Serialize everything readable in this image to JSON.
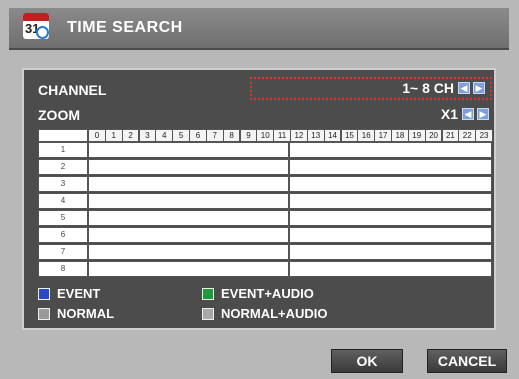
{
  "dialog": {
    "title": "TIME SEARCH",
    "icon": "calendar-clock-icon",
    "icon_number": "31"
  },
  "channel": {
    "label": "CHANNEL",
    "value": "1~ 8 CH"
  },
  "zoom": {
    "label": "ZOOM",
    "value": "X1"
  },
  "hours": [
    "0",
    "1",
    "2",
    "3",
    "4",
    "5",
    "6",
    "7",
    "8",
    "9",
    "10",
    "11",
    "12",
    "13",
    "14",
    "15",
    "16",
    "17",
    "18",
    "19",
    "20",
    "21",
    "22",
    "23"
  ],
  "rows": [
    "1",
    "2",
    "3",
    "4",
    "5",
    "6",
    "7",
    "8"
  ],
  "legend": {
    "event": {
      "label": "EVENT",
      "color": "#2a48c8"
    },
    "event_audio": {
      "label": "EVENT+AUDIO",
      "color": "#1f9a3a"
    },
    "normal": {
      "label": "NORMAL",
      "color": "#9a9a9a"
    },
    "normal_audio": {
      "label": "NORMAL+AUDIO",
      "color": "#a8a8a8"
    }
  },
  "buttons": {
    "ok": "OK",
    "cancel": "CANCEL"
  },
  "colors": {
    "panel": "#4c4c4c",
    "highlight": "#e03030",
    "arrow": "#7fa0d8"
  }
}
